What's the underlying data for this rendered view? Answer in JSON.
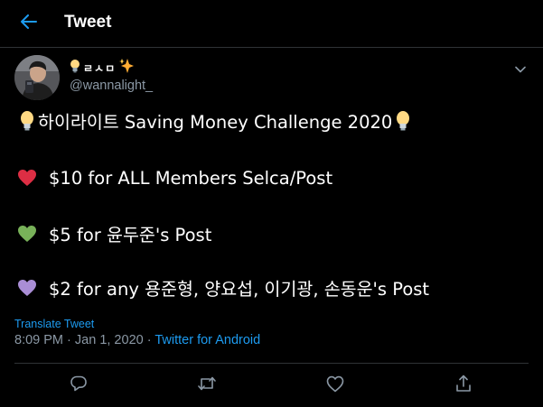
{
  "header": {
    "title": "Tweet",
    "back_icon": "arrow-left-icon",
    "accent_color": "#1d9bf0"
  },
  "author": {
    "display_name": "ㄹㅅㅁ",
    "name_prefix_emoji": "light-bulb-icon",
    "name_suffix_emoji": "sparkles-icon",
    "handle": "@wannalight_"
  },
  "tweet": {
    "lines": [
      {
        "emoji": "light-bulb-icon",
        "text": "하이라이트 Saving Money Challenge 2020",
        "trailing_emoji": "light-bulb-icon"
      },
      {
        "emoji": "red-heart-icon",
        "text": "$10 for ALL Members Selca/Post"
      },
      {
        "emoji": "green-heart-icon",
        "text": "$5 for 윤두준's Post"
      },
      {
        "emoji": "purple-heart-icon",
        "text": "$2 for any 용준형, 양요섭, 이기광, 손동운's Post"
      }
    ],
    "translate_label": "Translate Tweet",
    "time": "8:09 PM",
    "separator": "·",
    "date": "Jan 1, 2020",
    "source": "Twitter for Android"
  },
  "actions": {
    "reply_icon": "reply-icon",
    "retweet_icon": "retweet-icon",
    "like_icon": "heart-outline-icon",
    "share_icon": "share-icon"
  },
  "colors": {
    "background": "#000000",
    "secondary_text": "#8b98a5",
    "divider": "#2f3336",
    "heart_red": "#dd2e44",
    "heart_green": "#78b159",
    "heart_purple": "#aa8ed6"
  }
}
